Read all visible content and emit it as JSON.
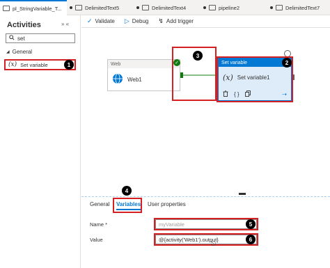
{
  "tabs": [
    {
      "label": "pl_StringVariable_T..."
    },
    {
      "label": "DelimitedText5"
    },
    {
      "label": "DelimitedText4"
    },
    {
      "label": "pipeline2"
    },
    {
      "label": "DelimitedText7"
    }
  ],
  "activities": {
    "title": "Activities",
    "collapse_icons": "» «",
    "search_value": "set",
    "group_label": "General",
    "item_label": "Set variable"
  },
  "toolbar": {
    "validate_label": "Validate",
    "debug_label": "Debug",
    "add_trigger_label": "Add trigger"
  },
  "canvas": {
    "web_node": {
      "type_label": "Web",
      "name": "Web1"
    },
    "set_node": {
      "type_label": "Set variable",
      "name": "Set variable1"
    }
  },
  "bottom": {
    "tabs": [
      {
        "label": "General"
      },
      {
        "label": "Variables"
      },
      {
        "label": "User properties"
      }
    ],
    "name_label": "Name *",
    "name_value": "myVariable",
    "value_label": "Value",
    "value_value": "@{activity('Web1').output}"
  },
  "badges": [
    "1",
    "2",
    "3",
    "4",
    "5",
    "6"
  ],
  "colors": {
    "accent": "#0078d4",
    "annotation": "#d42020",
    "success": "#107c10"
  }
}
